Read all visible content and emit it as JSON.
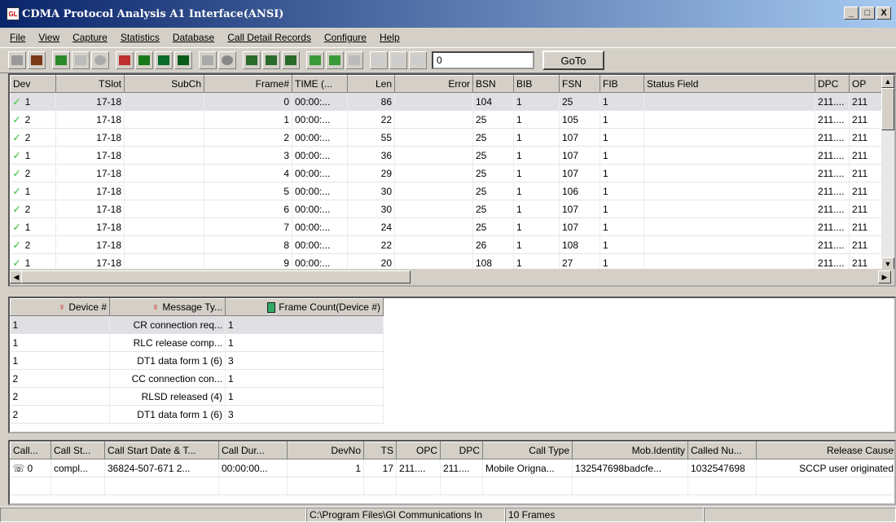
{
  "window": {
    "title": "CDMA Protocol Analysis A1 Interface(ANSI)",
    "icon_text": "GL",
    "min": "_",
    "max": "□",
    "close": "X"
  },
  "menu": [
    "File",
    "View",
    "Capture",
    "Statistics",
    "Database",
    "Call Detail Records",
    "Configure",
    "Help"
  ],
  "toolbar": {
    "goto_value": "0",
    "goto_label": "GoTo"
  },
  "frames": {
    "columns": [
      "Dev",
      "TSlot",
      "SubCh",
      "Frame#",
      "TIME (...",
      "Len",
      "Error",
      "BSN",
      "BIB",
      "FSN",
      "FIB",
      "Status Field",
      "DPC",
      "OP"
    ],
    "rows": [
      [
        "1",
        "17-18",
        "",
        "0",
        "00:00:...",
        "86",
        "",
        "104",
        "1",
        "25",
        "1",
        "",
        "211....",
        "211"
      ],
      [
        "2",
        "17-18",
        "",
        "1",
        "00:00:...",
        "22",
        "",
        "25",
        "1",
        "105",
        "1",
        "",
        "211....",
        "211"
      ],
      [
        "2",
        "17-18",
        "",
        "2",
        "00:00:...",
        "55",
        "",
        "25",
        "1",
        "107",
        "1",
        "",
        "211....",
        "211"
      ],
      [
        "1",
        "17-18",
        "",
        "3",
        "00:00:...",
        "36",
        "",
        "25",
        "1",
        "107",
        "1",
        "",
        "211....",
        "211"
      ],
      [
        "2",
        "17-18",
        "",
        "4",
        "00:00:...",
        "29",
        "",
        "25",
        "1",
        "107",
        "1",
        "",
        "211....",
        "211"
      ],
      [
        "1",
        "17-18",
        "",
        "5",
        "00:00:...",
        "30",
        "",
        "25",
        "1",
        "106",
        "1",
        "",
        "211....",
        "211"
      ],
      [
        "2",
        "17-18",
        "",
        "6",
        "00:00:...",
        "30",
        "",
        "25",
        "1",
        "107",
        "1",
        "",
        "211....",
        "211"
      ],
      [
        "1",
        "17-18",
        "",
        "7",
        "00:00:...",
        "24",
        "",
        "25",
        "1",
        "107",
        "1",
        "",
        "211....",
        "211"
      ],
      [
        "2",
        "17-18",
        "",
        "8",
        "00:00:...",
        "22",
        "",
        "26",
        "1",
        "108",
        "1",
        "",
        "211....",
        "211"
      ],
      [
        "1",
        "17-18",
        "",
        "9",
        "00:00:...",
        "20",
        "",
        "108",
        "1",
        "27",
        "1",
        "",
        "211....",
        "211"
      ]
    ]
  },
  "stats": {
    "columns": [
      "Device #",
      "Message Ty...",
      "Frame Count(Device #)"
    ],
    "rows": [
      [
        "1",
        "CR connection req...",
        "1"
      ],
      [
        "1",
        "RLC release comp...",
        "1"
      ],
      [
        "1",
        "DT1 data form 1 (6)",
        "3"
      ],
      [
        "2",
        "CC connection con...",
        "1"
      ],
      [
        "2",
        "RLSD released (4)",
        "1"
      ],
      [
        "2",
        "DT1 data form 1 (6)",
        "3"
      ]
    ]
  },
  "cdr": {
    "columns": [
      "Call...",
      "Call St...",
      "Call Start Date & T...",
      "Call Dur...",
      "DevNo",
      "TS",
      "OPC",
      "DPC",
      "Call Type",
      "Mob.Identity",
      "Called Nu...",
      "Release Cause"
    ],
    "rows": [
      [
        "0",
        "compl...",
        "36824-507-671 2...",
        "00:00:00...",
        "1",
        "17",
        "211....",
        "211....",
        "Mobile Origna...",
        "132547698badcfe...",
        "1032547698",
        "SCCP user originated"
      ]
    ]
  },
  "status": {
    "path": "C:\\Program Files\\GI Communications In",
    "frames": "10 Frames"
  }
}
